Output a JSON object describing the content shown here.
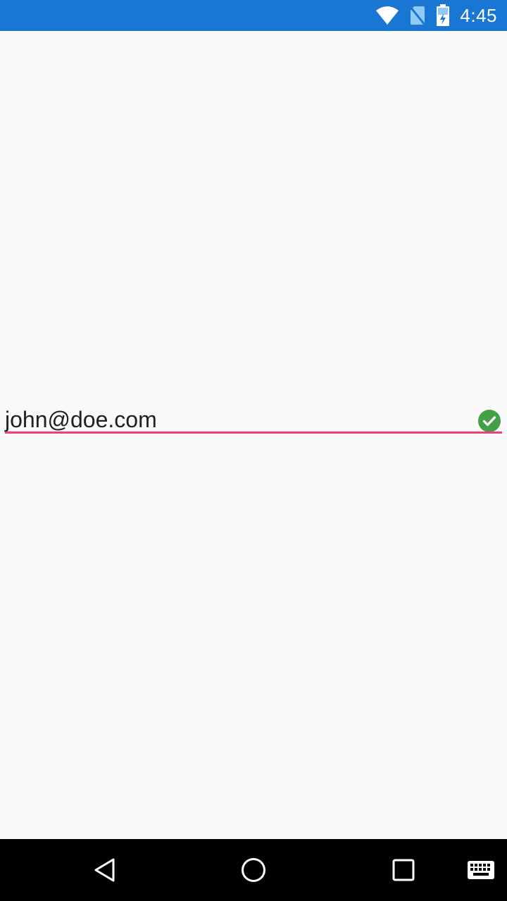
{
  "status_bar": {
    "time": "4:45",
    "icons": [
      "wifi-icon",
      "no-sim-icon",
      "battery-charging-icon"
    ],
    "background_color": "#1976d2"
  },
  "email_field": {
    "value": "john@doe.com",
    "validation_icon": "check-circle-icon",
    "validation_color": "#43a047",
    "underline_color": "#ec407a"
  },
  "nav_bar": {
    "buttons": [
      "back-icon",
      "home-icon",
      "recents-icon",
      "keyboard-icon"
    ],
    "background_color": "#000000"
  }
}
